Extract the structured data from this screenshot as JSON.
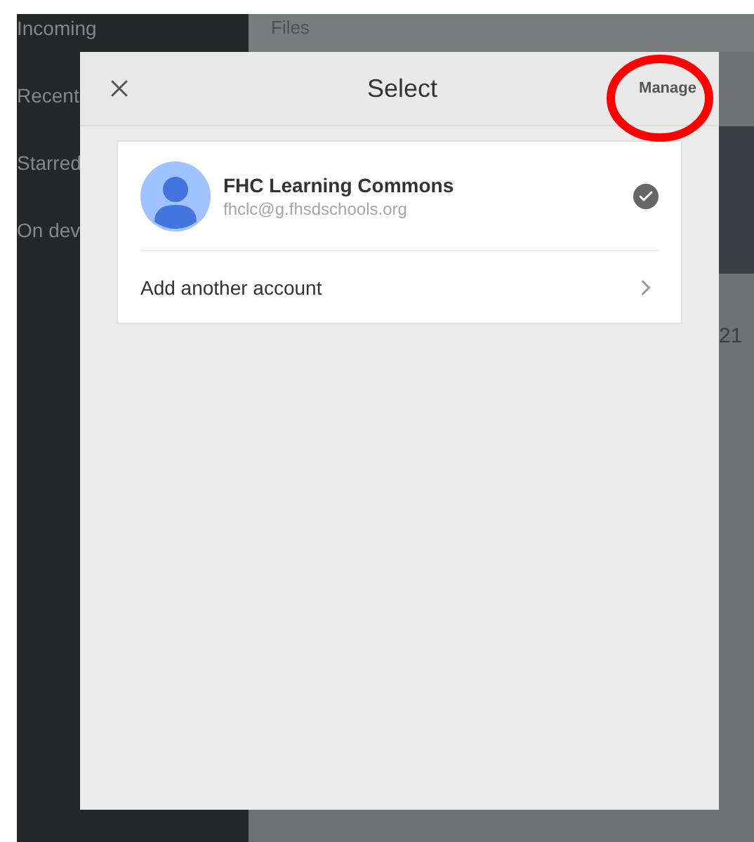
{
  "sidebar": {
    "items": [
      {
        "label": "Incoming"
      },
      {
        "label": "Recent"
      },
      {
        "label": "Starred"
      },
      {
        "label": "On dev"
      }
    ]
  },
  "main": {
    "title": "Files",
    "file_caption": "21"
  },
  "dialog": {
    "title": "Select",
    "manage_button": "Manage",
    "accounts": [
      {
        "name": "FHC Learning Commons",
        "email": "fhclc@g.fhsdschools.org",
        "selected": true
      }
    ],
    "add_account": "Add another account"
  }
}
